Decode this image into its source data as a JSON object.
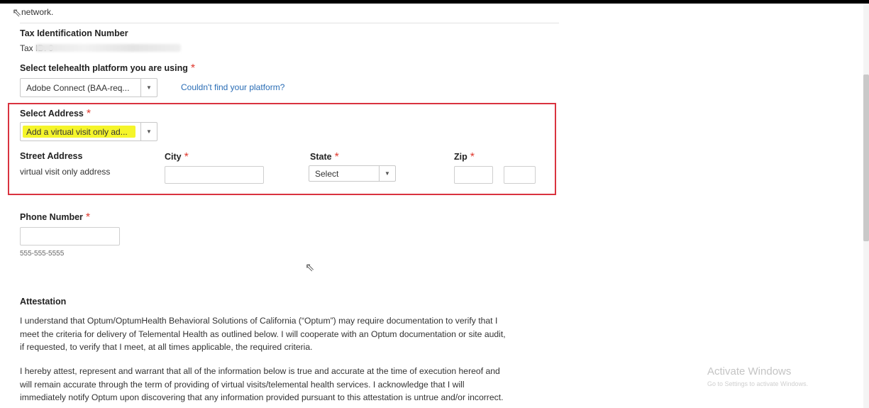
{
  "header": {
    "fragment": "network."
  },
  "tax": {
    "heading": "Tax Identification Number",
    "label": "Tax ID: 9"
  },
  "platform": {
    "label": "Select telehealth platform you are using",
    "selected": "Adobe Connect (BAA-req...",
    "help_link": "Couldn't find your platform?"
  },
  "address": {
    "label": "Select Address",
    "selected": "Add a virtual visit only ad...",
    "street_label": "Street Address",
    "street_value": "virtual visit only address",
    "city_label": "City",
    "state_label": "State",
    "state_selected": "Select",
    "zip_label": "Zip"
  },
  "phone": {
    "label": "Phone Number",
    "hint": "555-555-5555"
  },
  "attestation": {
    "heading": "Attestation",
    "p1": [
      "I understand that Optum/OptumHealth Behavioral Solutions of California (“Optum”) may require documentation to verify that I",
      "meet the criteria for delivery of Telemental Health as outlined below. I will cooperate with an Optum documentation or site audit,",
      "if requested, to verify that I meet, at all times applicable, the required criteria."
    ],
    "p2": [
      "I hereby attest, represent and warrant that all of the information below is true and accurate at the time of execution hereof and",
      "will remain accurate through the term of providing of virtual visits/telemental health services. I acknowledge that I will",
      "immediately notify Optum upon discovering that any information provided pursuant to this attestation is untrue and/or incorrect."
    ]
  },
  "required_marker": "*",
  "overlay": {
    "activate_title": "Activate Windows",
    "activate_sub": "Go to Settings to activate Windows."
  },
  "icons": {
    "dropdown": "▼",
    "cursor": "⇖"
  },
  "colors": {
    "required": "#e0392e",
    "highlight": "#f5f52a",
    "focus_border": "#d9333f",
    "link": "#2a6db5"
  }
}
